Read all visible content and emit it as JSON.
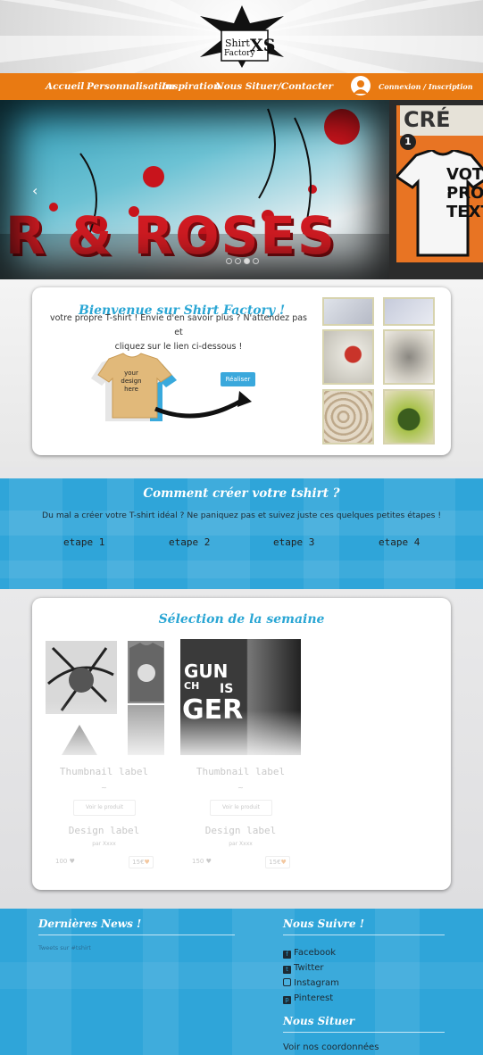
{
  "header": {
    "logo_text": [
      "Shirt",
      "Factory",
      "XS"
    ],
    "nav": [
      "Accueil",
      "Personnalisation",
      "Inspiration",
      "Nous Situer/Contacter"
    ],
    "login_label": "Connexion / Inscription"
  },
  "slider": {
    "left_text": "R & ROSES",
    "right_badge_number": "1",
    "right_title": "CRÉ",
    "right_shirt_text": [
      "VOTR",
      "PROP",
      "TEXT"
    ],
    "dot_count": 4,
    "active_dot": 2
  },
  "welcome": {
    "title": "Bienvenue sur Shirt Factory !",
    "text_line1": "votre propre T-shirt ! Envie d'en savoir plus ? N'attendez pas et",
    "text_line2": "cliquez sur le lien ci-dessous !",
    "shirt_text": [
      "your",
      "design",
      "here"
    ],
    "button_label": "Réaliser"
  },
  "how_to": {
    "title": "Comment créer votre tshirt ?",
    "subtitle": "Du mal a créer votre T-shirt idéal ? Ne paniquez pas et suivez juste ces quelques petites étapes !",
    "steps": [
      "etape 1",
      "etape 2",
      "etape 3",
      "etape 4"
    ]
  },
  "selection": {
    "title": "Sélection de la semaine",
    "products": [
      {
        "thumbnail_label": "Thumbnail label",
        "link": "Voir le produit",
        "design_label": "Design label",
        "author": "par Xxxx",
        "likes": "100",
        "price": "15€"
      },
      {
        "thumbnail_label": "Thumbnail label",
        "link": "Voir le produit",
        "design_label": "Design label",
        "author": "par Xxxx",
        "likes": "150",
        "price": "15€"
      }
    ],
    "image_text": [
      "GUN",
      "IS",
      "GER",
      "CH"
    ]
  },
  "footer": {
    "news_title": "Dernières News !",
    "tweets_label": "Tweets sur #tshirt",
    "follow_title": "Nous Suivre !",
    "social": [
      "Facebook",
      "Twitter",
      "Instagram",
      "Pinterest"
    ],
    "locate_title": "Nous Situer",
    "locate_link": "Voir nos coordonnées"
  },
  "colors": {
    "nav_orange": "#e97a12",
    "accent_blue": "#2fa5d9",
    "title_blue": "#2aa6d4",
    "button_blue": "#3aa8dc"
  },
  "icons": [
    "user-avatar-icon",
    "chevron-left-icon",
    "chevron-right-icon",
    "arrow-icon",
    "heart-icon",
    "facebook-icon",
    "twitter-icon",
    "instagram-icon",
    "pinterest-icon"
  ]
}
